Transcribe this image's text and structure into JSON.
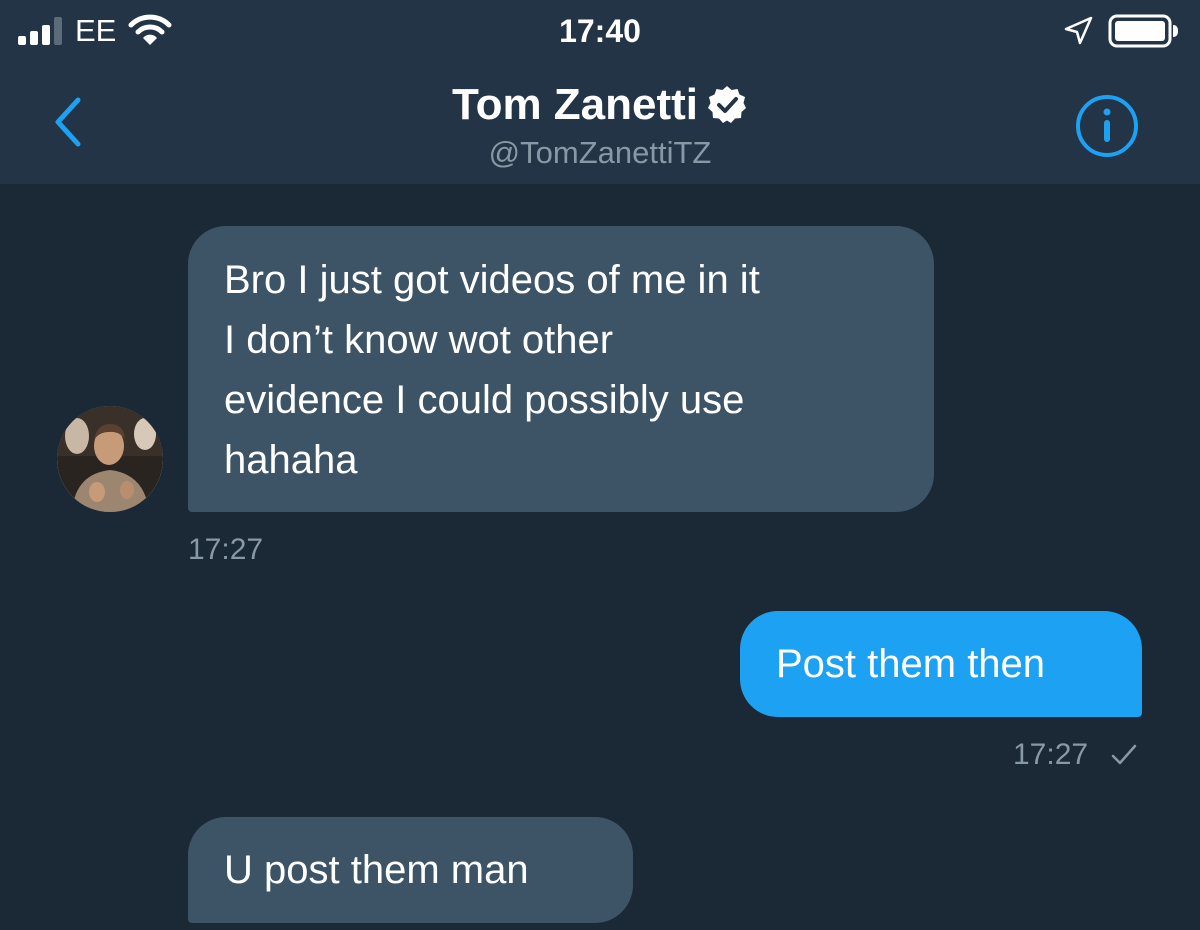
{
  "status_bar": {
    "carrier": "EE",
    "time": "17:40",
    "icons": [
      "signal-icon",
      "wifi-icon",
      "location-arrow-icon",
      "battery-icon"
    ]
  },
  "header": {
    "name": "Tom Zanetti",
    "handle": "@TomZanettiTZ",
    "verified": true,
    "icons": [
      "back-chevron-icon",
      "verified-badge-icon",
      "info-icon"
    ]
  },
  "conversation": {
    "messages": [
      {
        "direction": "incoming",
        "lines": [
          "Bro I just got videos of me in it",
          "I don’t know wot other",
          "evidence I could possibly use",
          "hahaha"
        ],
        "time": "17:27"
      },
      {
        "direction": "outgoing",
        "text": "Post them then",
        "time": "17:27",
        "status_icon": "checkmark-icon"
      },
      {
        "direction": "incoming",
        "text": "U post them man"
      }
    ]
  },
  "colors": {
    "background": "#1b2836",
    "header_background": "#243447",
    "incoming_bubble": "#3d5466",
    "outgoing_bubble": "#1da1f2",
    "accent": "#1da1f2",
    "secondary_text": "#8899a6"
  }
}
